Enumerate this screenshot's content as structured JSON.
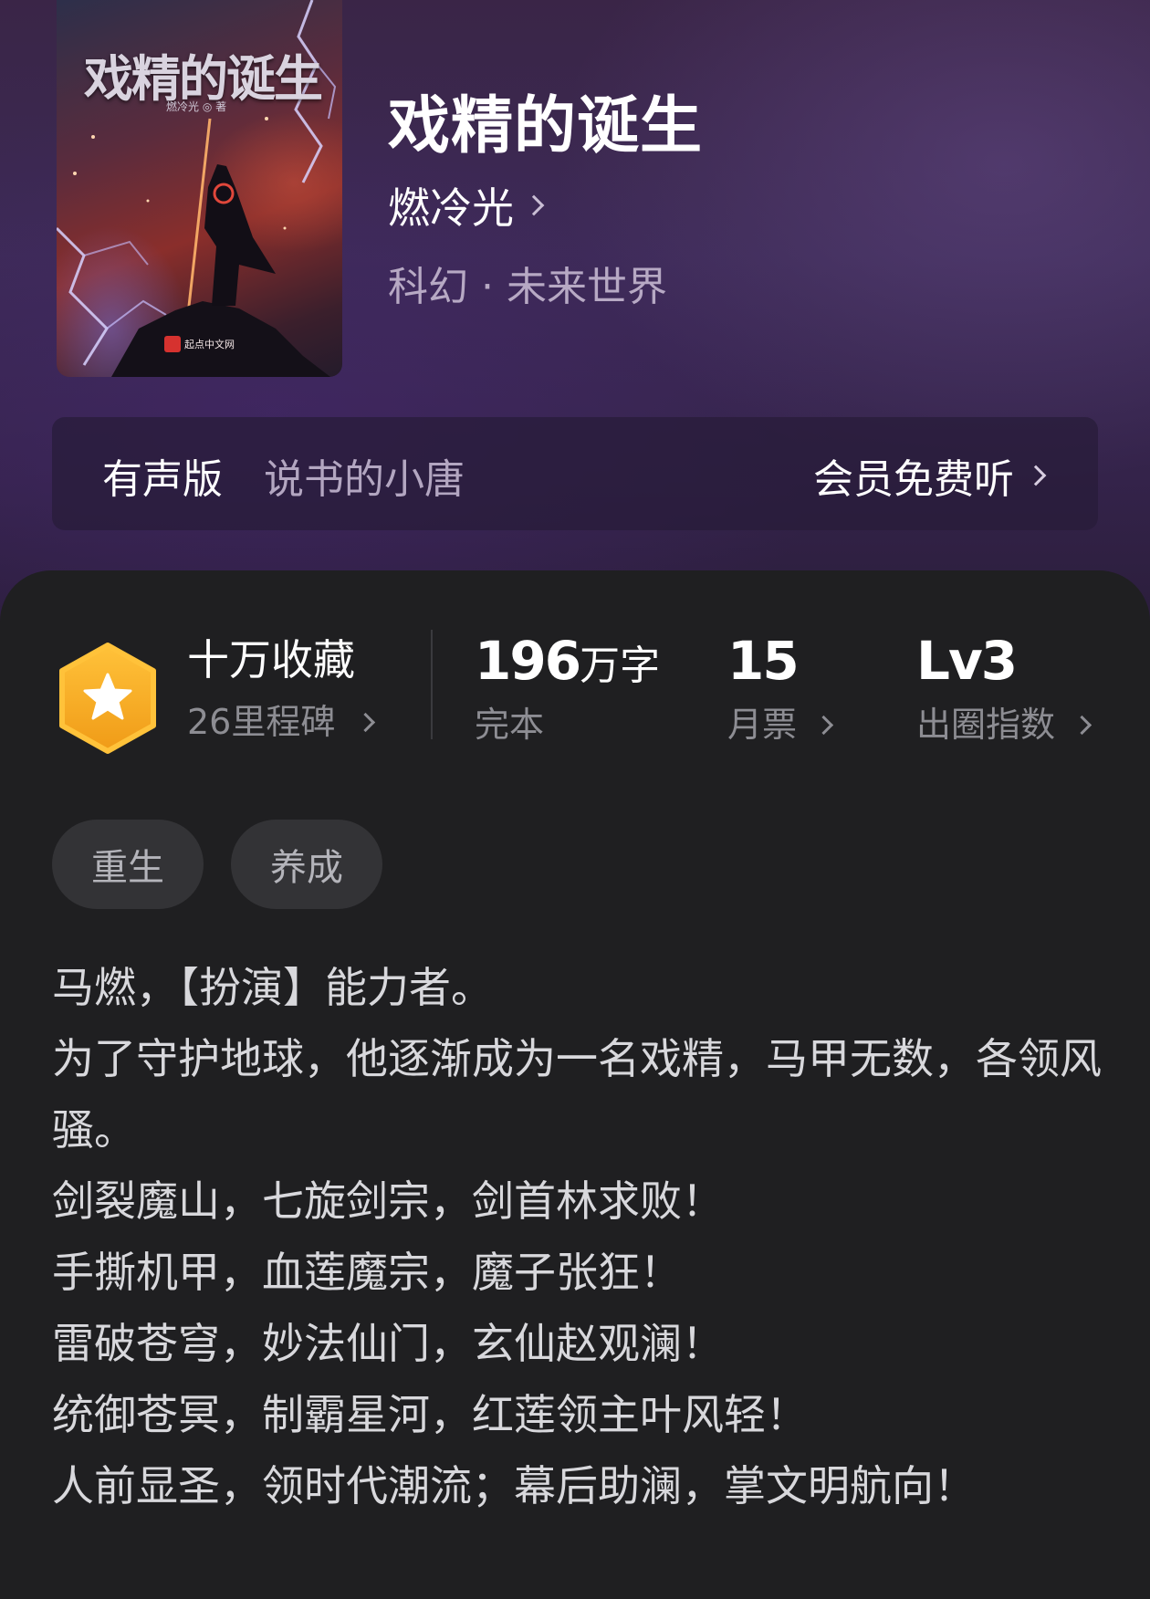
{
  "colors": {
    "header_bg": "#3a2547",
    "panel_bg": "#1f1f21",
    "badge": "#f5b52a",
    "text_primary": "#ffffff",
    "text_secondary": "#8d8d93",
    "tag_bg": "#333336"
  },
  "cover": {
    "title": "戏精的诞生",
    "author_line": "燃冷光 ◎ 著",
    "publisher": "起点中文网"
  },
  "book": {
    "title": "戏精的诞生",
    "author": "燃冷光",
    "genre": "科幻 · 未来世界"
  },
  "audio": {
    "label": "有声版",
    "narrator": "说书的小唐",
    "cta": "会员免费听"
  },
  "stats": {
    "collection": {
      "title": "十万收藏",
      "subtitle": "26里程碑",
      "icon": "star-badge-icon"
    },
    "words": {
      "number": "196",
      "unit": "万字",
      "label": "完本"
    },
    "tickets": {
      "number": "15",
      "label": "月票"
    },
    "index": {
      "number": "Lv3",
      "label": "出圈指数"
    }
  },
  "tags": [
    "重生",
    "养成"
  ],
  "description": [
    "马燃，【扮演】能力者。",
    "为了守护地球，他逐渐成为一名戏精，马甲无数，各领风骚。",
    "剑裂魔山，七旋剑宗，剑首林求败！",
    "手撕机甲，血莲魔宗，魔子张狂！",
    "雷破苍穹，妙法仙门，玄仙赵观澜！",
    "统御苍冥，制霸星河，红莲领主叶风轻！",
    "人前显圣，领时代潮流；幕后助澜，掌文明航向！"
  ]
}
